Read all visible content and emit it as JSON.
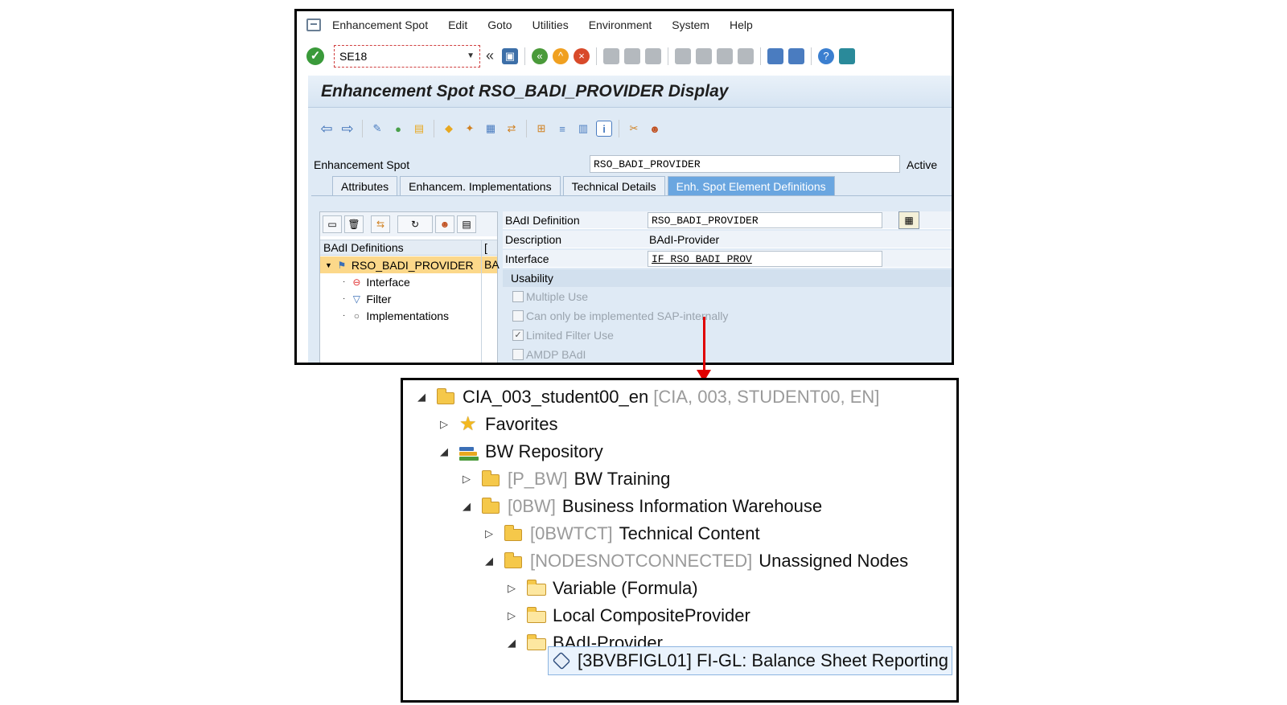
{
  "sap": {
    "menu": [
      "Enhancement Spot",
      "Edit",
      "Goto",
      "Utilities",
      "Environment",
      "System",
      "Help"
    ],
    "command_field": "SE18",
    "title": "Enhancement Spot RSO_BADI_PROVIDER Display",
    "enh_spot_label": "Enhancement Spot",
    "enh_spot_value": "RSO_BADI_PROVIDER",
    "enh_spot_status": "Active",
    "tabs": [
      "Attributes",
      "Enhancem. Implementations",
      "Technical Details",
      "Enh. Spot Element Definitions"
    ],
    "active_tab": "Enh. Spot Element Definitions",
    "tree": {
      "header_col1": "BAdI Definitions",
      "header_col2": "[",
      "root": "RSO_BADI_PROVIDER",
      "root_col2": "BA",
      "children": [
        "Interface",
        "Filter",
        "Implementations"
      ]
    },
    "definition": {
      "badi_label": "BAdI Definition",
      "badi_value": "RSO_BADI_PROVIDER",
      "desc_label": "Description",
      "desc_value": "BAdI-Provider",
      "iface_label": "Interface",
      "iface_value": "IF_RSO_BADI_PROV",
      "usability_label": "Usability",
      "checkboxes": [
        {
          "label": "Multiple Use",
          "checked": false
        },
        {
          "label": "Can only be implemented SAP-internally",
          "checked": false
        },
        {
          "label": "Limited Filter Use",
          "checked": true
        },
        {
          "label": "AMDP BAdI",
          "checked": false
        }
      ]
    }
  },
  "eclipse": {
    "project_name": "CIA_003_student00_en",
    "project_meta": "[CIA, 003, STUDENT00, EN]",
    "favorites": "Favorites",
    "bw_repository": "BW Repository",
    "p_bw_tag": "[P_BW]",
    "p_bw_name": "BW Training",
    "obw_tag": "[0BW]",
    "obw_name": "Business Information Warehouse",
    "obwtct_tag": "[0BWTCT]",
    "obwtct_name": "Technical Content",
    "nodes_tag": "[NODESNOTCONNECTED]",
    "nodes_name": "Unassigned Nodes",
    "variable": "Variable (Formula)",
    "local_cp": "Local CompositeProvider",
    "badi_provider": "BAdI-Provider",
    "selected_item": "[3BVBFIGL01] FI-GL: Balance Sheet Reporting"
  },
  "colors": {
    "arrow": "#e00000",
    "selected_row": "#fcd88a",
    "active_tab": "#6aa6e0"
  }
}
